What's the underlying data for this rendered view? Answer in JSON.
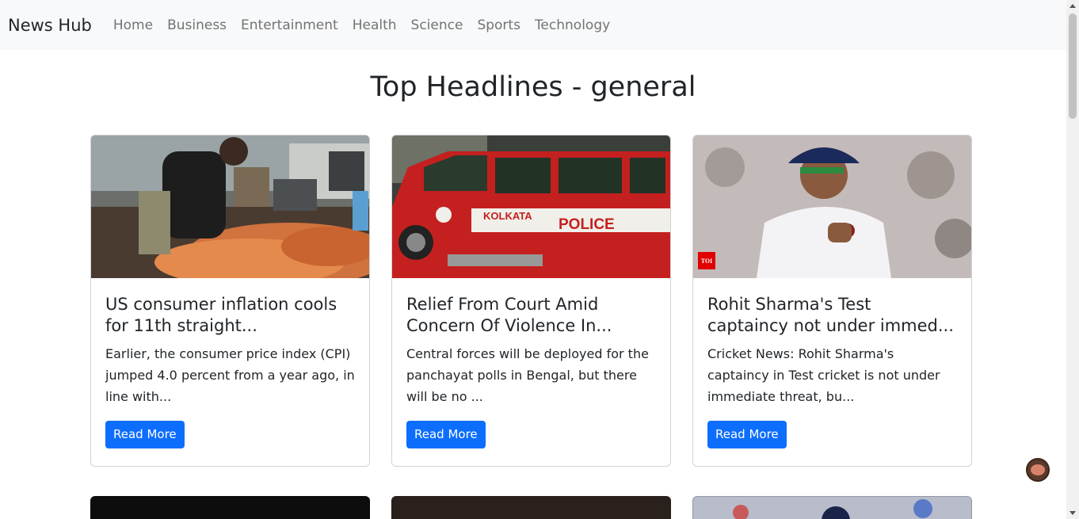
{
  "navbar": {
    "brand": "News Hub",
    "links": [
      "Home",
      "Business",
      "Entertainment",
      "Health",
      "Science",
      "Sports",
      "Technology"
    ]
  },
  "page": {
    "title": "Top Headlines - general"
  },
  "cards": [
    {
      "title": "US consumer inflation cools for 11th straight...",
      "description": "Earlier, the consumer price index (CPI) jumped 4.0 percent from a year ago, in line with...",
      "button": "Read More",
      "image_icon": "market-carrots-image"
    },
    {
      "title": "Relief From Court Amid Concern Of Violence In...",
      "description": "Central forces will be deployed for the panchayat polls in Bengal, but there will be no ...",
      "button": "Read More",
      "image_icon": "police-car-image",
      "image_text": [
        "KOLKATA",
        "POLICE"
      ]
    },
    {
      "title": "Rohit Sharma's Test captaincy not under immed...",
      "description": "Cricket News: Rohit Sharma's captaincy in Test cricket is not under immediate threat, bu...",
      "button": "Read More",
      "image_icon": "cricketer-image",
      "image_badge": "TOI"
    }
  ],
  "colors": {
    "primary": "#0d6efd",
    "navbar_bg": "#f8f9fa",
    "nav_link": "#737373"
  }
}
